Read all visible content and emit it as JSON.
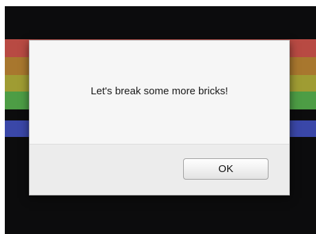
{
  "dialog": {
    "message": "Let's break some more bricks!",
    "ok_label": "OK"
  },
  "game": {
    "brick_colors": [
      "#b84a43",
      "#a8772e",
      "#9f9c33",
      "#4d9d45",
      "#3a47a8"
    ]
  }
}
